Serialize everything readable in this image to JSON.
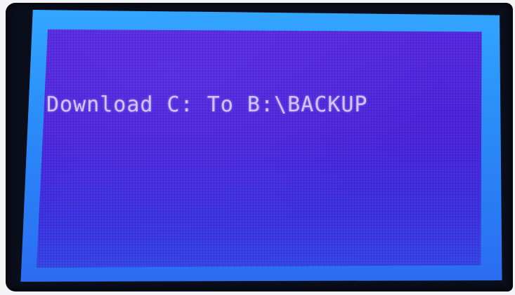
{
  "display": {
    "message": "Download C: To B:\\BACKUP"
  },
  "colors": {
    "backlight": "#2a8df8",
    "lcd_background": "#4e27e0",
    "lcd_text": "#cfc6ff",
    "bezel": "#0a0d1a"
  }
}
